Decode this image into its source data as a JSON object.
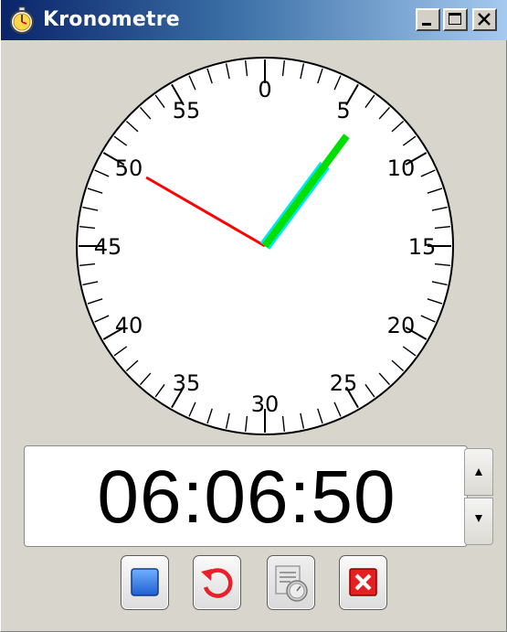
{
  "window": {
    "title": "Kronometre",
    "icon": "stopwatch-icon"
  },
  "caption_buttons": [
    {
      "name": "minimize",
      "icon": "minimize-icon"
    },
    {
      "name": "maximize",
      "icon": "maximize-icon"
    },
    {
      "name": "close",
      "icon": "close-icon"
    }
  ],
  "clock": {
    "dial_labels": [
      "0",
      "5",
      "10",
      "15",
      "20",
      "25",
      "30",
      "35",
      "40",
      "45",
      "50",
      "55"
    ],
    "hands": {
      "hour": {
        "value": 6.1,
        "color": "#00e5ff"
      },
      "minute": {
        "value": 6.1,
        "color": "#00e000"
      },
      "second": {
        "value": 50,
        "color": "#ff0000"
      }
    }
  },
  "display": {
    "time": "06:06:50"
  },
  "spinner": {
    "up_icon": "arrow-up-icon",
    "down_icon": "arrow-down-icon"
  },
  "toolbar": [
    {
      "name": "stop",
      "icon": "stop-square-icon",
      "enabled": true
    },
    {
      "name": "reset",
      "icon": "reset-arrow-icon",
      "enabled": true
    },
    {
      "name": "laps",
      "icon": "lap-stopwatch-icon",
      "enabled": false
    },
    {
      "name": "close",
      "icon": "close-x-icon",
      "enabled": true
    }
  ],
  "colors": {
    "title_gradient_start": "#0a246a",
    "title_gradient_end": "#a6caf0",
    "window_bg": "#d8d5cd"
  }
}
